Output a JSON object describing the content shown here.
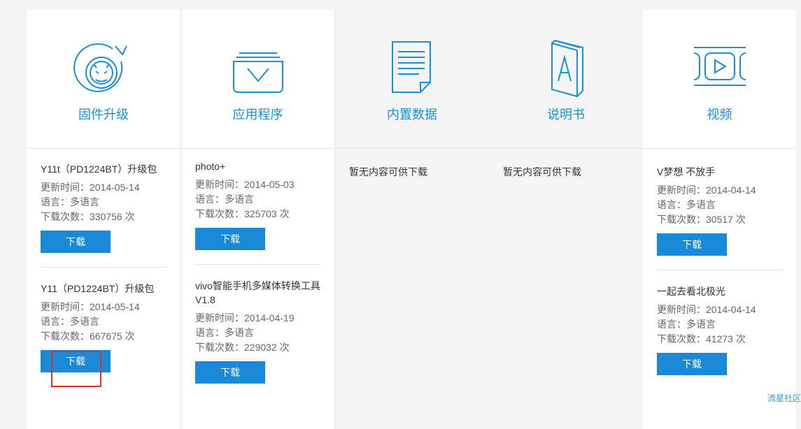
{
  "columns": [
    {
      "title": "固件升级",
      "icon": "firmware-upgrade-icon",
      "items": [
        {
          "name": "Y11t（PD1224BT）升级包",
          "updated": "更新时间：2014-05-14",
          "lang": "语言：多语言",
          "downloads": "下载次数：330756 次",
          "button": "下载"
        },
        {
          "name": "Y11（PD1224BT）升级包",
          "updated": "更新时间：2014-05-14",
          "lang": "语言：多语言",
          "downloads": "下载次数：667675 次",
          "button": "下载"
        }
      ]
    },
    {
      "title": "应用程序",
      "icon": "app-folder-icon",
      "items": [
        {
          "name": "photo+",
          "updated": "更新时间：2014-05-03",
          "lang": "语言：多语言",
          "downloads": "下载次数：325703 次",
          "button": "下载"
        },
        {
          "name": "vivo智能手机多媒体转换工具V1.8",
          "updated": "更新时间：2014-04-19",
          "lang": "语言：多语言",
          "downloads": "下载次数：229032 次",
          "button": "下载"
        }
      ]
    },
    {
      "title": "内置数据",
      "icon": "document-icon",
      "empty": "暂无内容可供下载"
    },
    {
      "title": "说明书",
      "icon": "manual-book-icon",
      "empty": "暂无内容可供下载"
    },
    {
      "title": "视频",
      "icon": "video-play-icon",
      "items": [
        {
          "name": "V梦想 不放手",
          "updated": "更新时间：2014-04-14",
          "lang": "语言：多语言",
          "downloads": "下载次数：30517 次",
          "button": "下载"
        },
        {
          "name": "一起去看北极光",
          "updated": "更新时间：2014-04-14",
          "lang": "语言：多语言",
          "downloads": "下载次数：41273 次",
          "button": "下载"
        }
      ]
    }
  ],
  "watermark": "流星社区",
  "colors": {
    "accent": "#1a8ad8",
    "highlight": "#e0302a"
  }
}
